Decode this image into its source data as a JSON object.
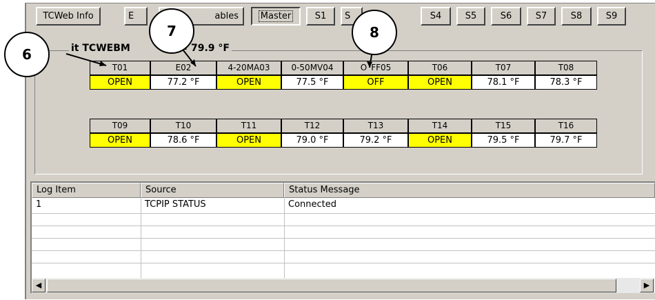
{
  "toolbar": {
    "buttons": [
      "TCWeb Info",
      "E",
      "ables",
      "Master",
      "S1",
      "S",
      "S4",
      "S5",
      "S6",
      "S7",
      "S8",
      "S9"
    ]
  },
  "group": {
    "title": "it TCWEBM",
    "title_suffix": "B = 79.9 °F"
  },
  "row1": {
    "headers": [
      "T01",
      "E02",
      "4-20MA03",
      "0-50MV04",
      "O",
      "FF05",
      "T06",
      "T07",
      "T08"
    ],
    "values": [
      "OPEN",
      "77.2 °F",
      "OPEN",
      "77.5 °F",
      "OFF",
      "OPEN",
      "78.1 °F",
      "78.3 °F"
    ]
  },
  "row2": {
    "headers": [
      "T09",
      "T10",
      "T11",
      "T12",
      "T13",
      "T14",
      "T15",
      "T16"
    ],
    "values": [
      "OPEN",
      "78.6 °F",
      "OPEN",
      "79.0 °F",
      "79.2 °F",
      "OPEN",
      "79.5 °F",
      "79.7 °F"
    ]
  },
  "log": {
    "headers": [
      "Log Item",
      "Source",
      "Status Message"
    ],
    "rows": [
      [
        "1",
        "TCPIP STATUS",
        "Connected"
      ]
    ]
  },
  "callouts": [
    "6",
    "7",
    "8"
  ],
  "colors": {
    "open_highlight": "#ffff00",
    "panel": "#d4d0c8"
  }
}
